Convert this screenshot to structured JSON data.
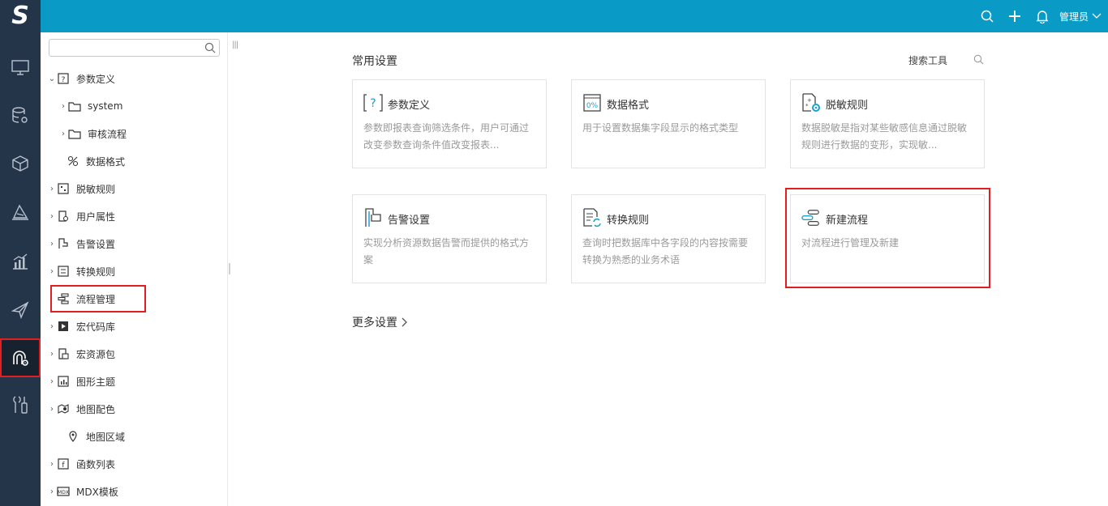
{
  "header": {
    "logo_text": "S",
    "user_label": "管理员",
    "icons": [
      "search-icon",
      "plus-icon",
      "bell-icon",
      "chevron-down-icon"
    ],
    "bar_color": "#0a9ac6",
    "rail_color": "#243549",
    "highlight_color": "#e02020"
  },
  "rail": {
    "items": [
      "monitor-icon",
      "database-settings-icon",
      "cube-icon",
      "layers-icon",
      "chart-icon",
      "send-icon",
      "workflow-settings-icon",
      "tools-icon"
    ],
    "active_index": 6
  },
  "tree": {
    "search_placeholder": "",
    "nodes": [
      {
        "label": "参数定义",
        "expanded": true,
        "icon": "parameter-icon"
      },
      {
        "label": "system",
        "icon": "folder-icon"
      },
      {
        "label": "审核流程",
        "icon": "folder-icon"
      },
      {
        "label": "数据格式",
        "icon": "format-icon"
      },
      {
        "label": "脱敏规则",
        "icon": "mask-icon"
      },
      {
        "label": "用户属性",
        "icon": "user-attr-icon"
      },
      {
        "label": "告警设置",
        "icon": "flag-icon"
      },
      {
        "label": "转换规则",
        "icon": "convert-icon"
      },
      {
        "label": "流程管理",
        "icon": "flow-icon",
        "highlighted": true
      },
      {
        "label": "宏代码库",
        "icon": "macro-icon"
      },
      {
        "label": "宏资源包",
        "icon": "package-icon"
      },
      {
        "label": "图形主题",
        "icon": "chart-theme-icon"
      },
      {
        "label": "地图配色",
        "icon": "map-color-icon"
      },
      {
        "label": "地图区域",
        "icon": "map-pin-icon"
      },
      {
        "label": "函数列表",
        "icon": "function-icon"
      },
      {
        "label": "MDX模板",
        "icon": "mdx-icon"
      }
    ]
  },
  "main": {
    "title": "常用设置",
    "search_tool_label": "搜索工具",
    "cards": [
      {
        "title": "参数定义",
        "desc": "参数即报表查询筛选条件，用户可通过改变参数查询条件值改变报表...",
        "icon": "parameter-icon"
      },
      {
        "title": "数据格式",
        "desc": "用于设置数据集字段显示的格式类型",
        "icon": "percent-format-icon"
      },
      {
        "title": "脱敏规则",
        "desc": "数据脱敏是指对某些敏感信息通过脱敏规则进行数据的变形，实现敏...",
        "icon": "mask-settings-icon"
      },
      {
        "title": "告警设置",
        "desc": "实现分析资源数据告警而提供的格式方案",
        "icon": "flag-icon"
      },
      {
        "title": "转换规则",
        "desc": "查询时把数据库中各字段的内容按需要转换为熟悉的业务术语",
        "icon": "convert-doc-icon"
      },
      {
        "title": "新建流程",
        "desc": "对流程进行管理及新建",
        "icon": "flow-icon",
        "highlighted": true
      }
    ],
    "more_label": "更多设置"
  }
}
